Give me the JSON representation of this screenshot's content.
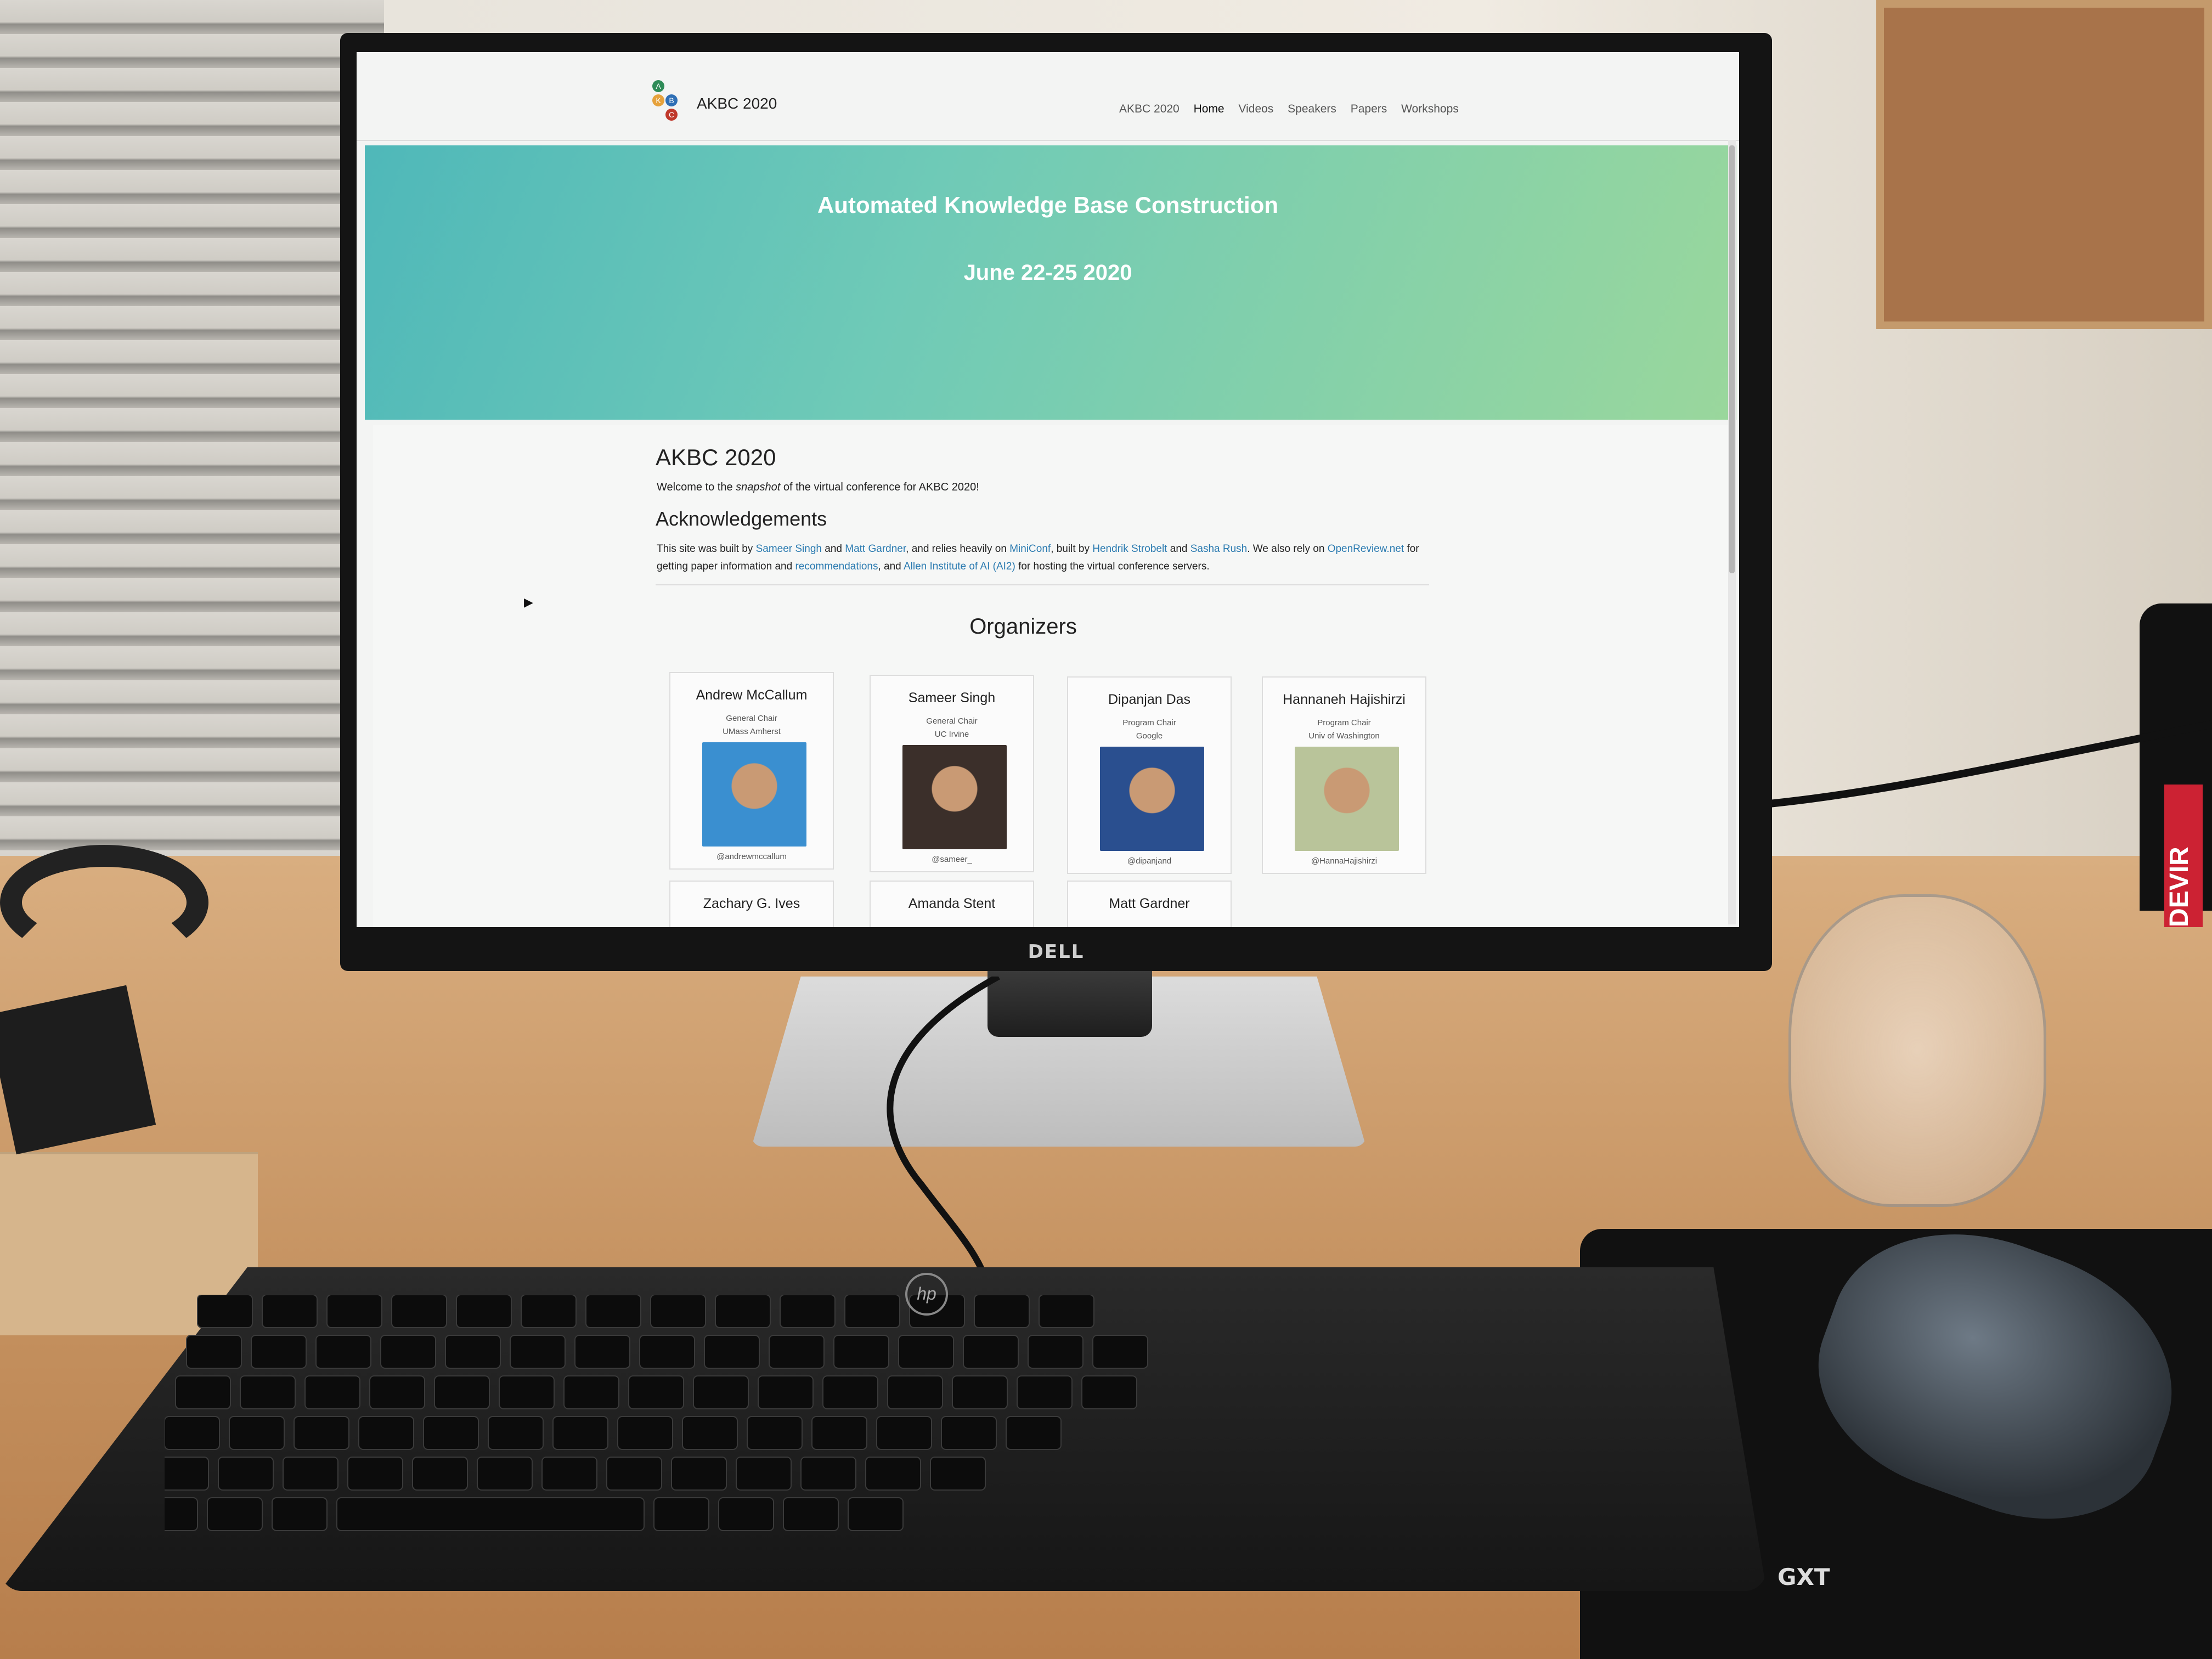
{
  "site": {
    "brand": "AKBC 2020",
    "logo_letters": [
      "A",
      "K",
      "B",
      "C"
    ],
    "nav": [
      "AKBC 2020",
      "Home",
      "Videos",
      "Speakers",
      "Papers",
      "Workshops"
    ],
    "active_nav": "Home"
  },
  "hero": {
    "title": "Automated Knowledge Base Construction",
    "date": "June 22-25 2020"
  },
  "intro": {
    "title": "AKBC 2020",
    "welcome_pre": "Welcome to the ",
    "welcome_em": "snapshot",
    "welcome_post": " of the virtual conference for AKBC 2020!"
  },
  "acknowledgements": {
    "title": "Acknowledgements",
    "parts": [
      {
        "text": "This site was built by ",
        "link": false
      },
      {
        "text": "Sameer Singh",
        "link": true
      },
      {
        "text": " and ",
        "link": false
      },
      {
        "text": "Matt Gardner",
        "link": true
      },
      {
        "text": ", and relies heavily on ",
        "link": false
      },
      {
        "text": "MiniConf",
        "link": true
      },
      {
        "text": ", built by ",
        "link": false
      },
      {
        "text": "Hendrik Strobelt",
        "link": true
      },
      {
        "text": " and ",
        "link": false
      },
      {
        "text": "Sasha Rush",
        "link": true
      },
      {
        "text": ". We also rely on ",
        "link": false
      },
      {
        "text": "OpenReview.net",
        "link": true
      },
      {
        "text": " for getting paper information and ",
        "link": false
      },
      {
        "text": "recommendations",
        "link": true
      },
      {
        "text": ", and ",
        "link": false
      },
      {
        "text": "Allen Institute of AI (AI2)",
        "link": true
      },
      {
        "text": " for hosting the virtual conference servers.",
        "link": false
      }
    ]
  },
  "organizers": {
    "title": "Organizers",
    "people": [
      {
        "name": "Andrew McCallum",
        "role": "General Chair",
        "affiliation": "UMass Amherst",
        "handle": "@andrewmccallum",
        "photo_color": "#3a8fd0"
      },
      {
        "name": "Sameer Singh",
        "role": "General Chair",
        "affiliation": "UC Irvine",
        "handle": "@sameer_",
        "photo_color": "#3b2f2a"
      },
      {
        "name": "Dipanjan Das",
        "role": "Program Chair",
        "affiliation": "Google",
        "handle": "@dipanjand",
        "photo_color": "#2a4f8f"
      },
      {
        "name": "Hannaneh Hajishirzi",
        "role": "Program Chair",
        "affiliation": "Univ of Washington",
        "handle": "@HannaHajishirzi",
        "photo_color": "#b9c49a"
      }
    ],
    "next_row": [
      "Zachary G. Ives",
      "Amanda Stent",
      "Matt Gardner"
    ]
  },
  "hardware": {
    "monitor_brand": "DELL",
    "keyboard_brand": "hp",
    "mousepad_brand": "GXT",
    "box_label": "DEVIR"
  }
}
